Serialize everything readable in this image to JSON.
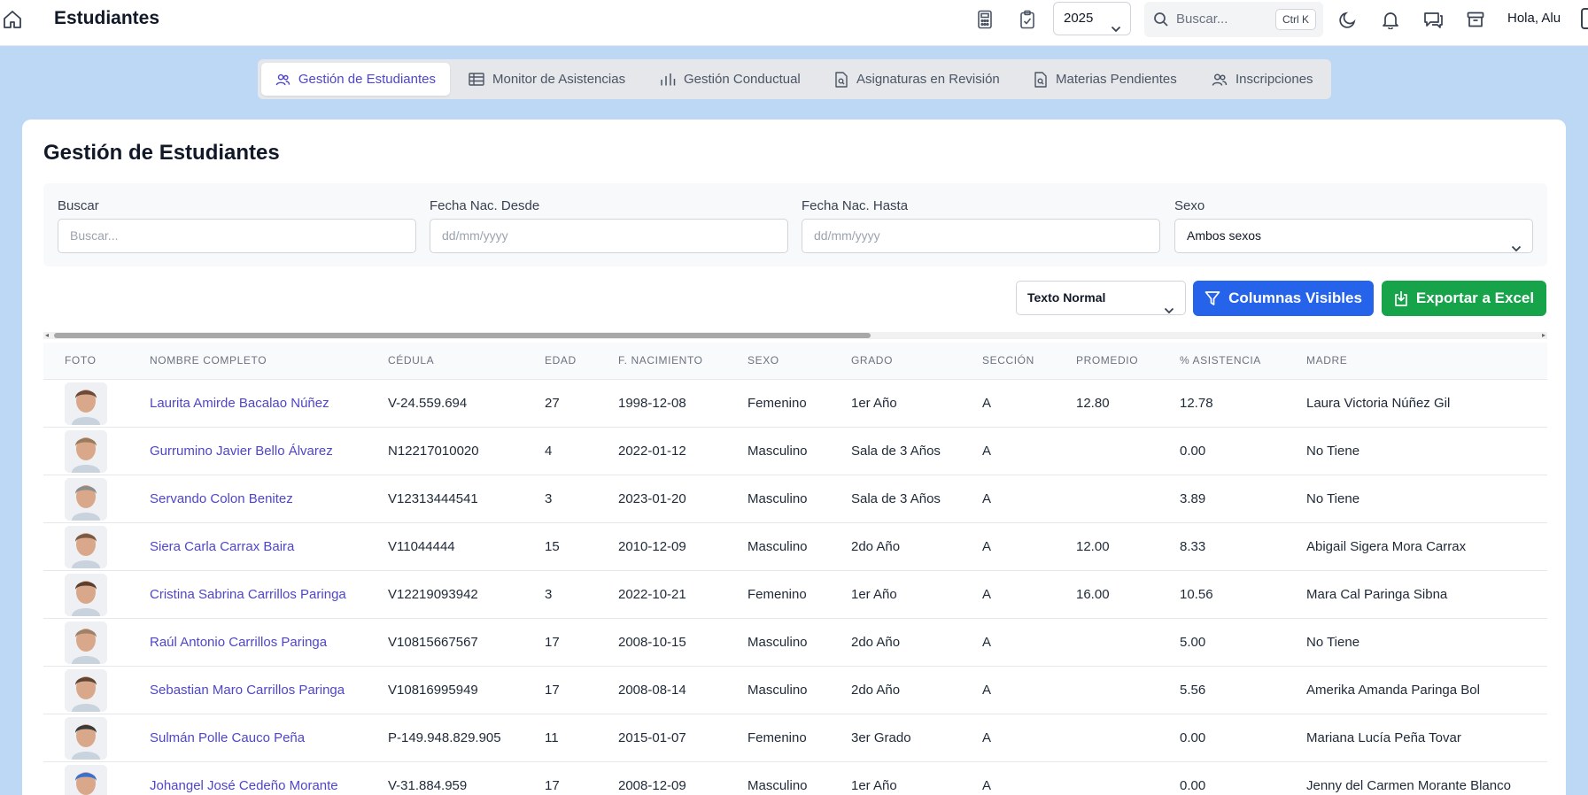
{
  "header": {
    "title": "Estudiantes",
    "year": "2025",
    "search_placeholder": "Buscar...",
    "shortcut": "Ctrl K",
    "greeting": "Hola, Alu"
  },
  "tabs": [
    {
      "label": "Gestión de Estudiantes",
      "active": true
    },
    {
      "label": "Monitor de Asistencias"
    },
    {
      "label": "Gestión Conductual"
    },
    {
      "label": "Asignaturas en Revisión"
    },
    {
      "label": "Materias Pendientes"
    },
    {
      "label": "Inscripciones"
    }
  ],
  "page": {
    "title": "Gestión de Estudiantes"
  },
  "filters": {
    "search_label": "Buscar",
    "search_placeholder": "Buscar...",
    "from_label": "Fecha Nac. Desde",
    "from_placeholder": "dd/mm/yyyy",
    "to_label": "Fecha Nac. Hasta",
    "to_placeholder": "dd/mm/yyyy",
    "sex_label": "Sexo",
    "sex_value": "Ambos sexos"
  },
  "toolbar": {
    "text_mode": "Texto Normal",
    "columns_button": "Columnas Visibles",
    "export_button": "Exportar a Excel"
  },
  "table": {
    "headers": [
      "FOTO",
      "NOMBRE COMPLETO",
      "CÉDULA",
      "EDAD",
      "F. NACIMIENTO",
      "SEXO",
      "GRADO",
      "SECCIÓN",
      "PROMEDIO",
      "% ASISTENCIA",
      "MADRE"
    ],
    "rows": [
      {
        "name": "Laurita Amirde Bacalao Núñez",
        "cedula": "V-24.559.694",
        "edad": "27",
        "fnac": "1998-12-08",
        "sexo": "Femenino",
        "grado": "1er Año",
        "seccion": "A",
        "promedio": "12.80",
        "asistencia": "12.78",
        "madre": "Laura Victoria Núñez Gil",
        "photo_color": "#6b4a3a"
      },
      {
        "name": "Gurrumino Javier Bello Álvarez",
        "cedula": "N12217010020",
        "edad": "4",
        "fnac": "2022-01-12",
        "sexo": "Masculino",
        "grado": "Sala de 3 Años",
        "seccion": "A",
        "promedio": "",
        "asistencia": "0.00",
        "madre": "No Tiene",
        "photo_color": "#9a7a5c"
      },
      {
        "name": "Servando Colon Benitez",
        "cedula": "V12313444541",
        "edad": "3",
        "fnac": "2023-01-20",
        "sexo": "Masculino",
        "grado": "Sala de 3 Años",
        "seccion": "A",
        "promedio": "",
        "asistencia": "3.89",
        "madre": "No Tiene",
        "photo_color": "#8d8d8d"
      },
      {
        "name": "Siera Carla Carrax Baira",
        "cedula": "V11044444",
        "edad": "15",
        "fnac": "2010-12-09",
        "sexo": "Masculino",
        "grado": "2do Año",
        "seccion": "A",
        "promedio": "12.00",
        "asistencia": "8.33",
        "madre": "Abigail Sigera Mora Carrax",
        "photo_color": "#7a5a44"
      },
      {
        "name": "Cristina Sabrina Carrillos Paringa",
        "cedula": "V12219093942",
        "edad": "3",
        "fnac": "2022-10-21",
        "sexo": "Femenino",
        "grado": "1er Año",
        "seccion": "A",
        "promedio": "16.00",
        "asistencia": "10.56",
        "madre": "Mara Cal Paringa Sibna",
        "photo_color": "#5a3e30"
      },
      {
        "name": "Raúl Antonio Carrillos Paringa",
        "cedula": "V10815667567",
        "edad": "17",
        "fnac": "2008-10-15",
        "sexo": "Masculino",
        "grado": "2do Año",
        "seccion": "A",
        "promedio": "",
        "asistencia": "5.00",
        "madre": "No Tiene",
        "photo_color": "#a08068"
      },
      {
        "name": "Sebastian Maro Carrillos Paringa",
        "cedula": "V10816995949",
        "edad": "17",
        "fnac": "2008-08-14",
        "sexo": "Masculino",
        "grado": "2do Año",
        "seccion": "A",
        "promedio": "",
        "asistencia": "5.56",
        "madre": "Amerika Amanda Paringa Bol",
        "photo_color": "#5e4534"
      },
      {
        "name": "Sulmán Polle Cauco Peña",
        "cedula": "P-149.948.829.905",
        "edad": "11",
        "fnac": "2015-01-07",
        "sexo": "Femenino",
        "grado": "3er Grado",
        "seccion": "A",
        "promedio": "",
        "asistencia": "0.00",
        "madre": "Mariana Lucía Peña Tovar",
        "photo_color": "#3a3a3a"
      },
      {
        "name": "Johangel José Cedeño Morante",
        "cedula": "V-31.884.959",
        "edad": "17",
        "fnac": "2008-12-09",
        "sexo": "Masculino",
        "grado": "1er Año",
        "seccion": "A",
        "promedio": "",
        "asistencia": "0.00",
        "madre": "Jenny del Carmen Morante Blanco",
        "photo_color": "#3b6fd0"
      }
    ]
  },
  "colors": {
    "background": "#bcd8f4",
    "accent": "#4f46c8",
    "primary_button": "#2563eb",
    "export_button": "#16a34a"
  }
}
